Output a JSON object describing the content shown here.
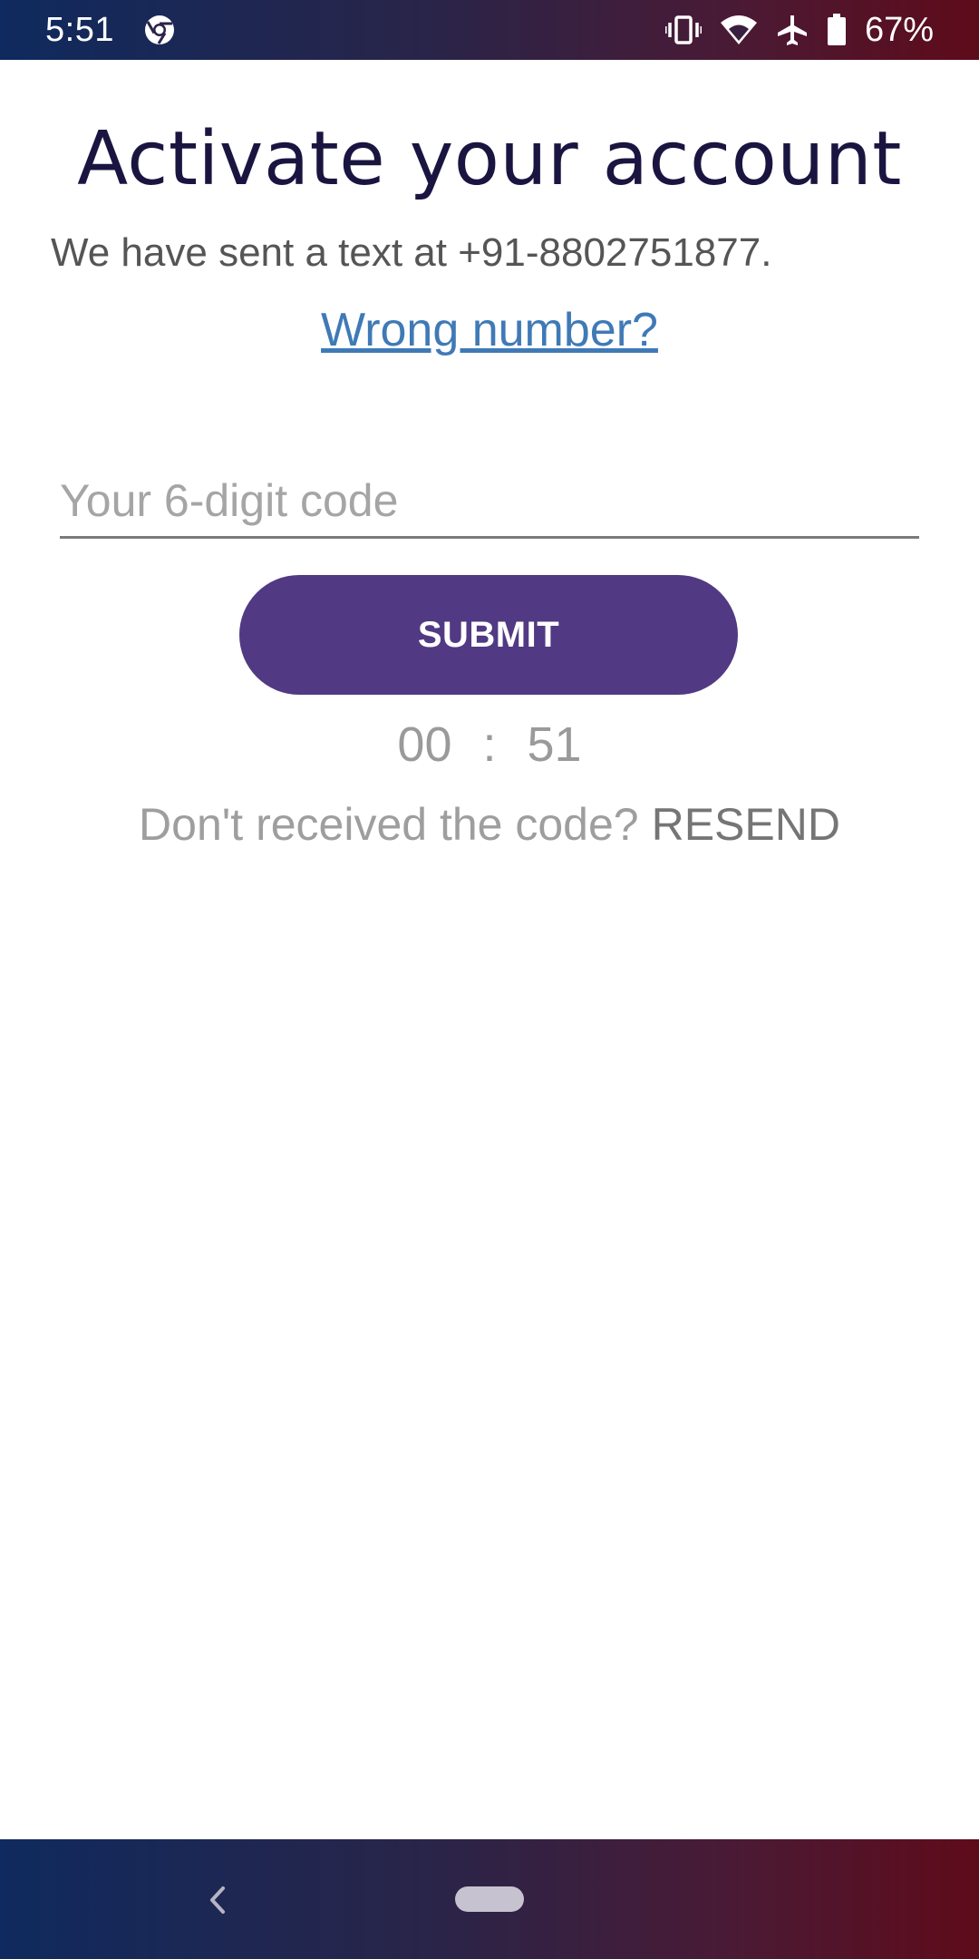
{
  "status_bar": {
    "time": "5:51",
    "icons": [
      "chrome-icon",
      "vibrate-icon",
      "wifi-icon",
      "airplane-icon",
      "battery-icon"
    ],
    "battery_percent": "67%"
  },
  "page": {
    "title": "Activate your account",
    "subtitle": "We have sent a text at +91-8802751877.",
    "wrong_number_link": "Wrong number?"
  },
  "code_input": {
    "value": "",
    "placeholder": "Your 6-digit code"
  },
  "submit_button": {
    "label": "SUBMIT"
  },
  "timer": {
    "minutes": "00",
    "separator": ":",
    "seconds": "51"
  },
  "resend": {
    "prompt": "Don't received the code?",
    "link": "RESEND"
  },
  "nav_bar": {
    "icons": [
      "back-icon",
      "home-pill"
    ]
  },
  "colors": {
    "title": "#1a1540",
    "link": "#3f7ab6",
    "button": "#523983",
    "bar_gradient_start": "#0f2a5e",
    "bar_gradient_end": "#5e0b1a"
  }
}
